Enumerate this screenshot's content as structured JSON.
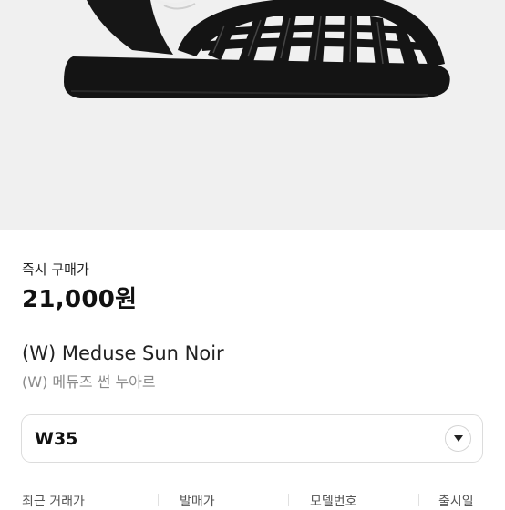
{
  "product": {
    "image_alt": "black jelly fisherman sandal",
    "price_label": "즉시 구매가",
    "price": "21,000원",
    "name_en": "(W) Meduse Sun Noir",
    "name_ko": "(W) 메듀즈 썬 누아르"
  },
  "size_select": {
    "value": "W35"
  },
  "meta": {
    "labels": [
      "최근 거래가",
      "발매가",
      "모델번호",
      "출시일"
    ]
  },
  "colors": {
    "hero_bg": "#f0f0f0",
    "sandal": "#141414"
  }
}
